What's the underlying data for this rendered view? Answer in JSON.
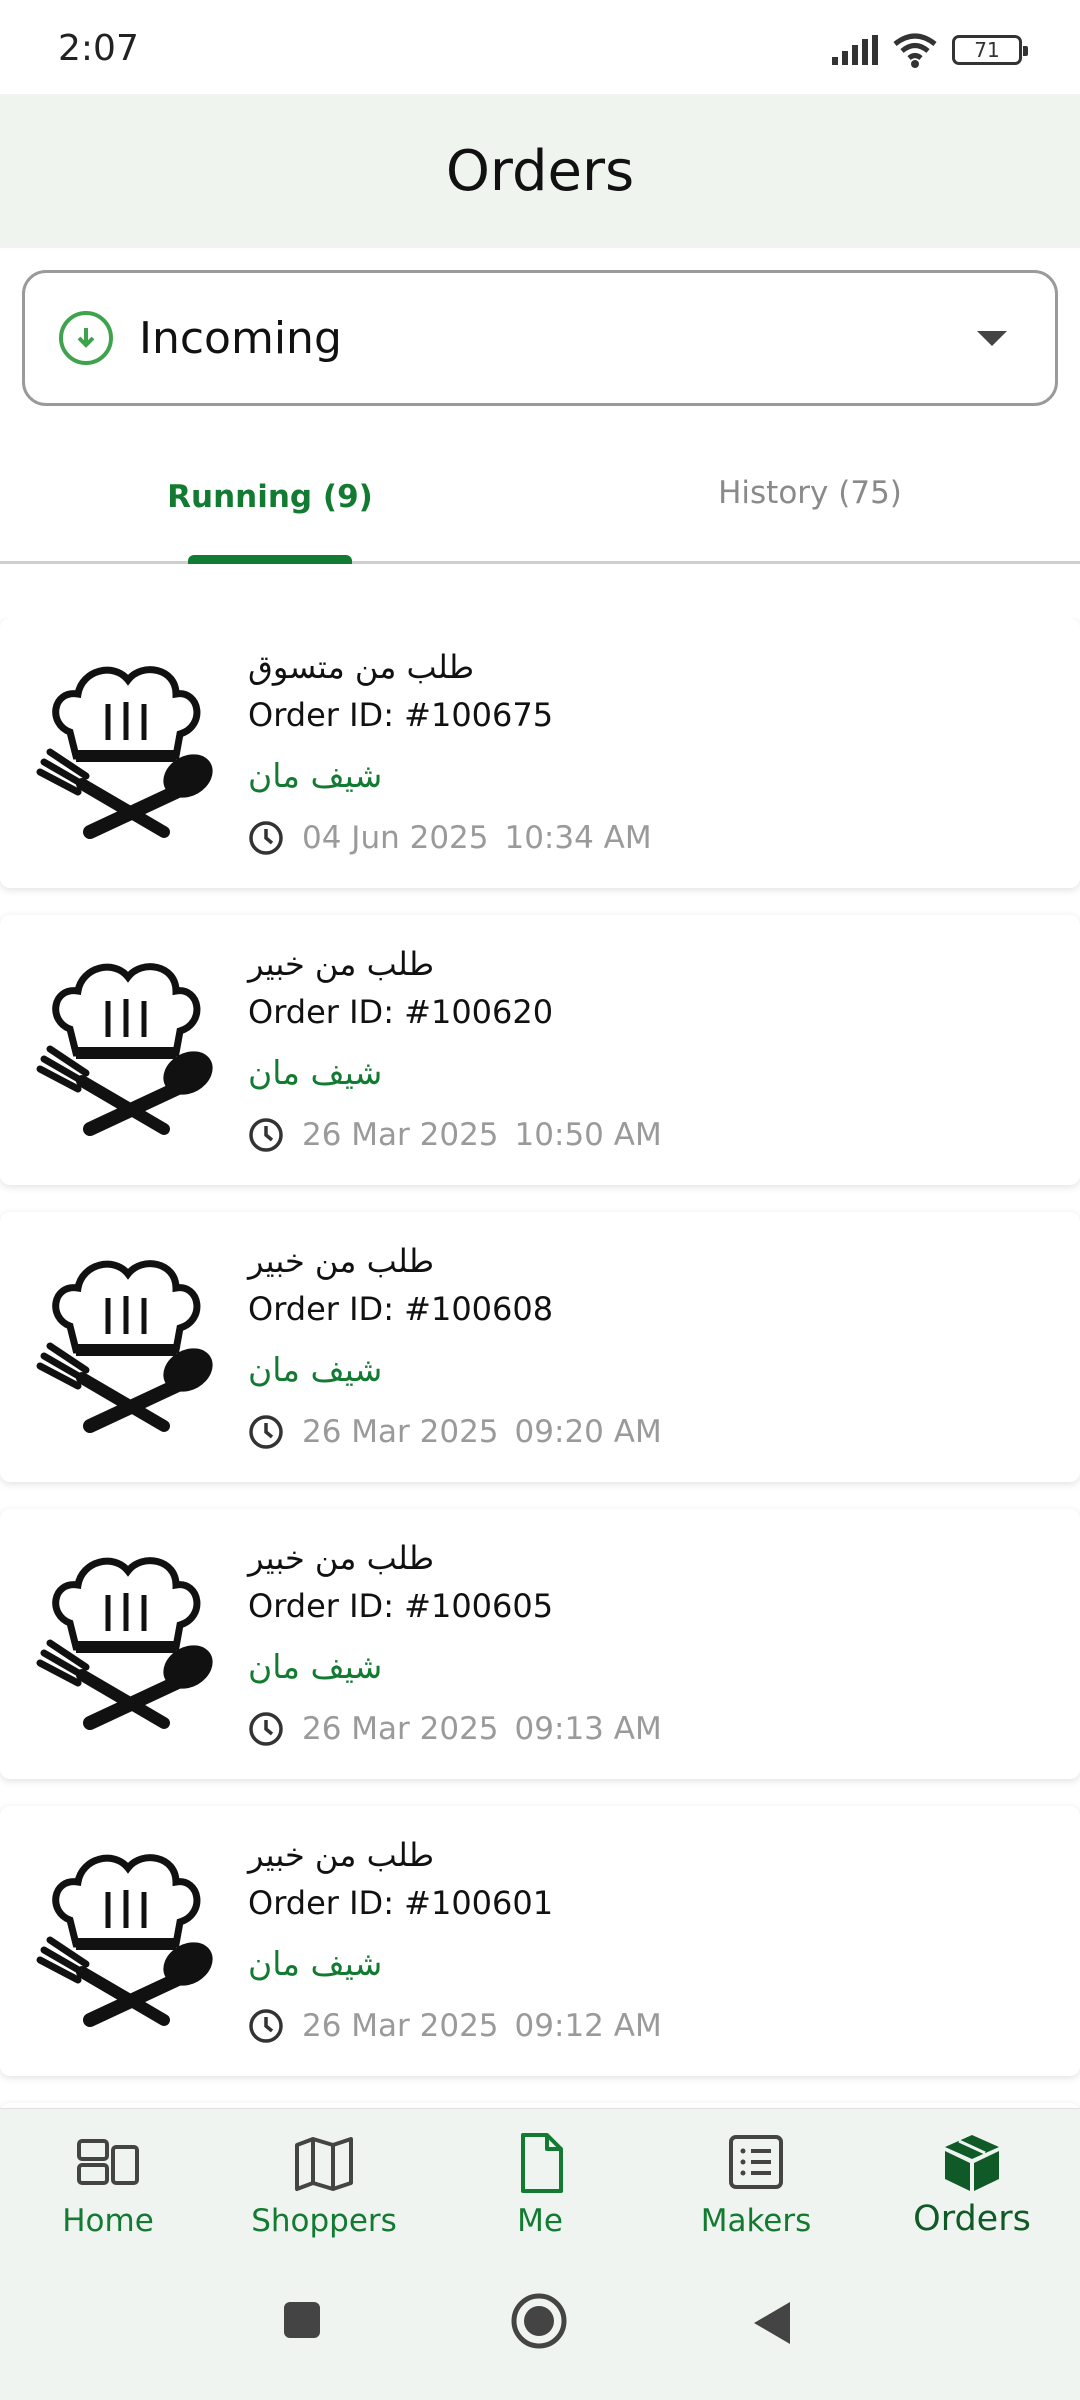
{
  "status_bar": {
    "time": "2:07",
    "battery": "71"
  },
  "header": {
    "title": "Orders"
  },
  "filter": {
    "selected": "Incoming"
  },
  "tabs": [
    {
      "label": "Running (9)",
      "active": true
    },
    {
      "label": "History (75)",
      "active": false
    }
  ],
  "orders": [
    {
      "title": "طلب من متسوق",
      "id_label": "Order ID:",
      "id": "#100675",
      "chef": "شيف مان",
      "date": "04 Jun 2025",
      "time": "10:34 AM"
    },
    {
      "title": "طلب من خبير",
      "id_label": "Order ID:",
      "id": "#100620",
      "chef": "شيف مان",
      "date": "26 Mar 2025",
      "time": "10:50 AM"
    },
    {
      "title": "طلب من خبير",
      "id_label": "Order ID:",
      "id": "#100608",
      "chef": "شيف مان",
      "date": "26 Mar 2025",
      "time": "09:20 AM"
    },
    {
      "title": "طلب من خبير",
      "id_label": "Order ID:",
      "id": "#100605",
      "chef": "شيف مان",
      "date": "26 Mar 2025",
      "time": "09:13 AM"
    },
    {
      "title": "طلب من خبير",
      "id_label": "Order ID:",
      "id": "#100601",
      "chef": "شيف مان",
      "date": "26 Mar 2025",
      "time": "09:12 AM"
    }
  ],
  "bottom_nav": [
    {
      "label": "Home",
      "icon": "dashboard-icon",
      "active": false
    },
    {
      "label": "Shoppers",
      "icon": "map-icon",
      "active": false
    },
    {
      "label": "Me",
      "icon": "document-icon",
      "active": false
    },
    {
      "label": "Makers",
      "icon": "list-icon",
      "active": false
    },
    {
      "label": "Orders",
      "icon": "package-icon",
      "active": true
    }
  ],
  "colors": {
    "accent": "#137a32",
    "header_bg": "#eff4ef",
    "muted": "#9a9a9a",
    "incoming_icon": "#3fa34d"
  }
}
